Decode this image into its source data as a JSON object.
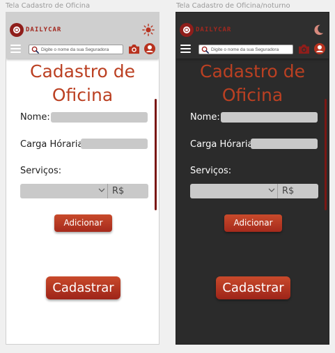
{
  "frames": [
    {
      "label": "Tela Cadastro de Oficina",
      "theme": "light",
      "theme_icon": "sun-icon"
    },
    {
      "label": "Tela Cadastro de Oficina/noturno",
      "theme": "dark",
      "theme_icon": "moon-icon"
    }
  ],
  "header": {
    "logo_text": "DAILYCAR",
    "search_placeholder": "Digite o nome da sua Seguradora",
    "icons": [
      "menu-icon",
      "search-icon",
      "camera-icon",
      "user-icon"
    ]
  },
  "form": {
    "title_line1": "Cadastro de",
    "title_line2": "Oficina",
    "name_label": "Nome:",
    "hours_label": "Carga Hóraria:",
    "services_label": "Serviços:",
    "currency_symbol": "R$",
    "add_button": "Adicionar",
    "submit_button": "Cadastrar"
  },
  "colors": {
    "accent": "#bb4022",
    "brand": "#8f1e1b",
    "light_header": "#cfcfcf",
    "dark_bg": "#2b2b2b",
    "field": "#c9c9c9"
  }
}
